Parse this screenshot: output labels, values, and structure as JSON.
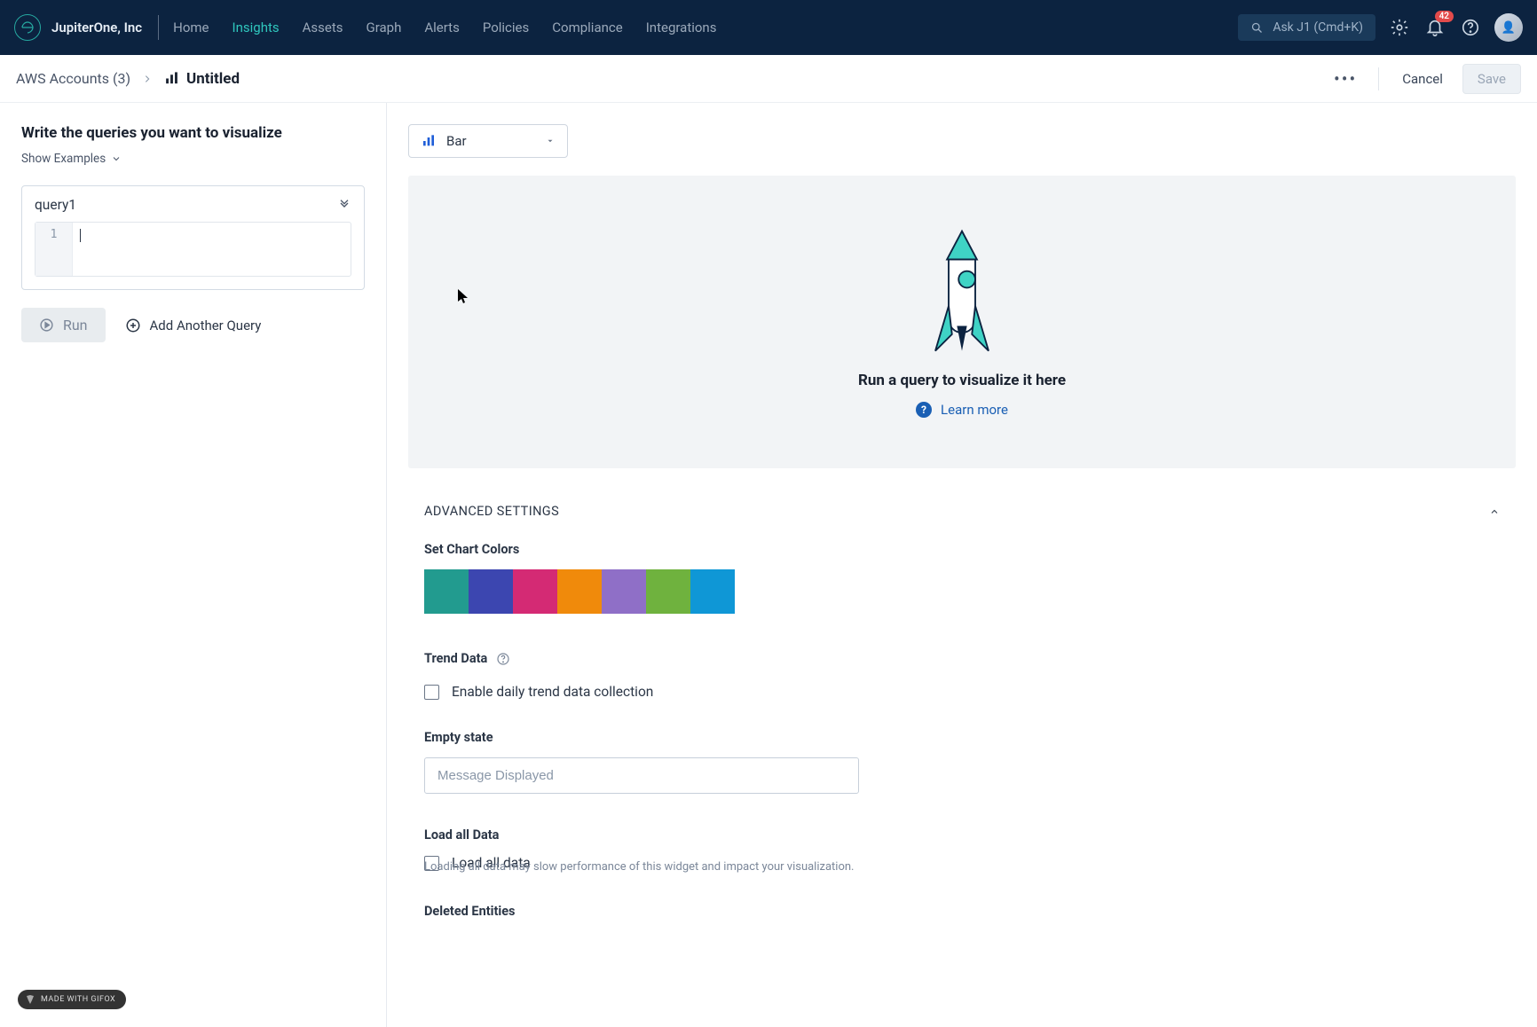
{
  "header": {
    "org_name": "JupiterOne, Inc",
    "nav": [
      "Home",
      "Insights",
      "Assets",
      "Graph",
      "Alerts",
      "Policies",
      "Compliance",
      "Integrations"
    ],
    "nav_active_index": 1,
    "search_placeholder": "Ask J1 (Cmd+K)",
    "notification_count": "42"
  },
  "subheader": {
    "breadcrumb": "AWS Accounts (3)",
    "title": "Untitled",
    "cancel_label": "Cancel",
    "save_label": "Save"
  },
  "left": {
    "heading": "Write the queries you want to visualize",
    "show_examples": "Show Examples",
    "query_name": "query1",
    "gutter_line": "1",
    "run_label": "Run",
    "add_query_label": "Add Another Query"
  },
  "right": {
    "viz_type": "Bar",
    "empty_prompt": "Run a query to visualize it here",
    "learn_more": "Learn more"
  },
  "advanced": {
    "header": "ADVANCED SETTINGS",
    "colors_label": "Set Chart Colors",
    "colors": [
      "#229b8f",
      "#3c46b0",
      "#d42a74",
      "#f08a0b",
      "#8f6fc7",
      "#6fb23e",
      "#0f97d6"
    ],
    "trend_label": "Trend Data",
    "trend_checkbox_label": "Enable daily trend data collection",
    "empty_state_label": "Empty state",
    "empty_state_placeholder": "Message Displayed",
    "load_all_label": "Load all Data",
    "load_all_checkbox_label": "Load all data",
    "load_all_hint": "Loading all data may slow performance of this widget and impact your visualization.",
    "deleted_label": "Deleted Entities"
  },
  "footer_badge": "MADE WITH GIFOX"
}
